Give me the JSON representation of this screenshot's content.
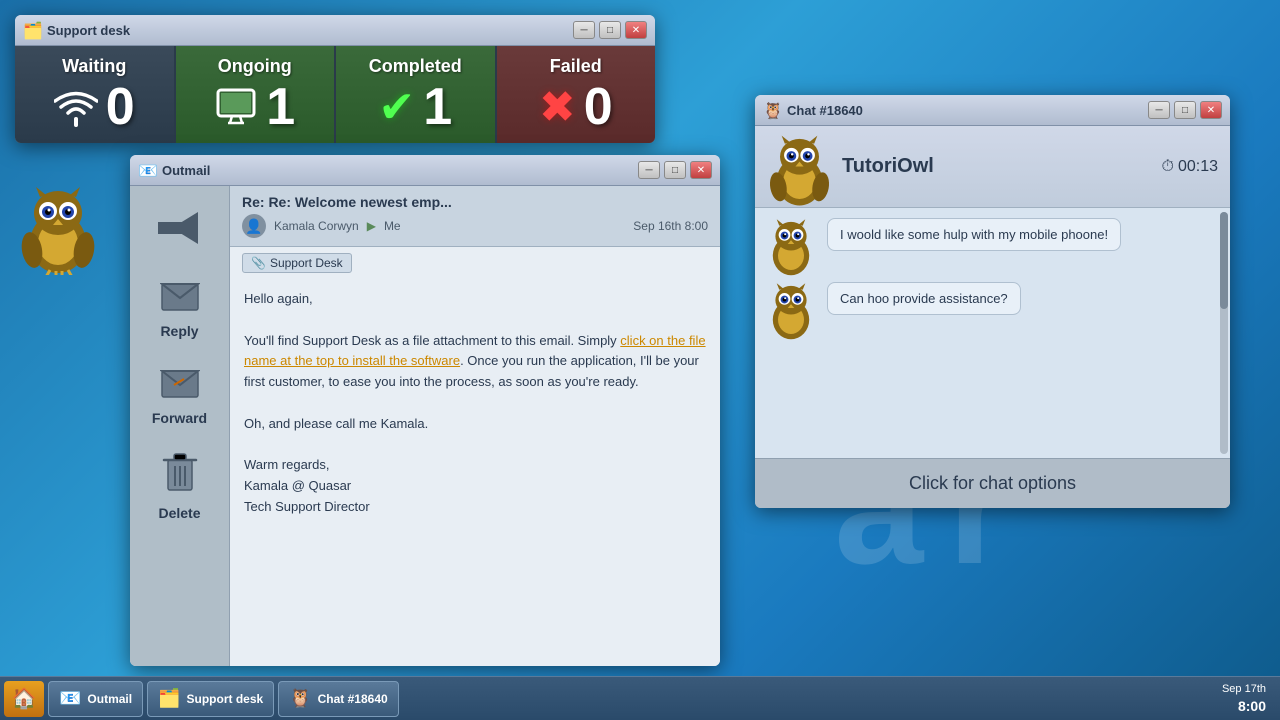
{
  "desktop": {
    "background_text": "a r"
  },
  "support_desk_window": {
    "title": "Support desk",
    "title_icon": "🗂️",
    "stats": [
      {
        "key": "waiting",
        "label": "Waiting",
        "count": "0",
        "icon_type": "wifi",
        "bg": "waiting"
      },
      {
        "key": "ongoing",
        "label": "Ongoing",
        "count": "1",
        "icon_type": "monitor",
        "bg": "ongoing"
      },
      {
        "key": "completed",
        "label": "Completed",
        "count": "1",
        "icon_type": "check",
        "bg": "completed"
      },
      {
        "key": "failed",
        "label": "Failed",
        "count": "0",
        "icon_type": "xmark",
        "bg": "failed"
      }
    ],
    "controls": {
      "minimize": "─",
      "maximize": "□",
      "close": "✕"
    }
  },
  "outmail_window": {
    "title": "Outmail",
    "title_icon": "📧",
    "sidebar_buttons": [
      {
        "key": "reply",
        "label": "Reply",
        "icon": "✉️"
      },
      {
        "key": "forward",
        "label": "Forward",
        "icon": "📨"
      },
      {
        "key": "delete",
        "label": "Delete",
        "icon": "🗑️"
      }
    ],
    "email": {
      "subject": "Re: Re: Welcome newest emp...",
      "date": "Sep 16th 8:00",
      "from": "Kamala Corwyn",
      "to": "Me",
      "attachment": "Support Desk",
      "body_lines": [
        "Hello again,",
        "",
        "You'll find Support Desk as a file attachment to this email. Simply click on the file name at the top to install the software. Once you run the application, I'll be your first customer, to ease you into the process, as soon as you're ready.",
        "",
        "Oh, and please call me Kamala.",
        "",
        "Warm regards,",
        "Kamala @ Quasar",
        "Tech Support Director"
      ],
      "link_text": "click on the file name at the top to install the software"
    },
    "controls": {
      "minimize": "─",
      "maximize": "□",
      "close": "✕"
    }
  },
  "chat_window": {
    "title": "Chat #18640",
    "title_icon": "🦉",
    "contact_name": "TutoriOwl",
    "timer": "00:13",
    "messages": [
      {
        "text": "I woold like some hulp with my mobile phoone!",
        "sender": "owl"
      },
      {
        "text": "Can hoo provide assistance?",
        "sender": "owl"
      }
    ],
    "options_bar_label": "Click for chat options",
    "controls": {
      "minimize": "─",
      "maximize": "□",
      "close": "✕"
    }
  },
  "taskbar": {
    "start_icon": "🏠",
    "items": [
      {
        "key": "outmail",
        "label": "Outmail",
        "icon": "📧"
      },
      {
        "key": "support-desk",
        "label": "Support desk",
        "icon": "🗂️"
      },
      {
        "key": "chat",
        "label": "Chat #18640",
        "icon": "🦉"
      }
    ],
    "clock": {
      "date": "Sep 17th",
      "time": "8:00"
    }
  }
}
